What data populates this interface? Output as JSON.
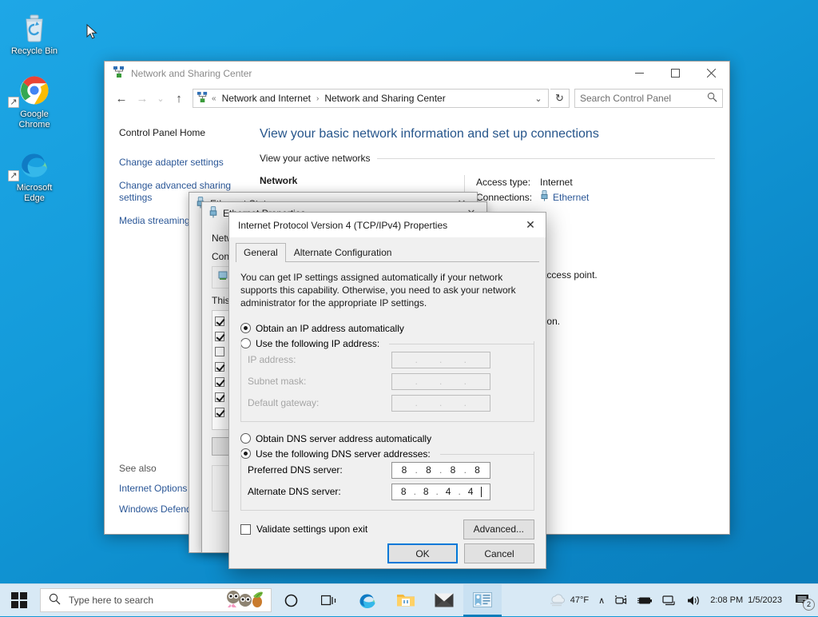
{
  "desktop": {
    "icons": [
      {
        "name": "Recycle Bin",
        "icon": "recycle-bin-icon"
      },
      {
        "name": "Google\nChrome",
        "label_line1": "Google",
        "label_line2": "Chrome",
        "icon": "chrome-icon"
      },
      {
        "name": "Microsoft\nEdge",
        "label_line1": "Microsoft",
        "label_line2": "Edge",
        "icon": "edge-icon"
      }
    ]
  },
  "control_panel_window": {
    "title": "Network and Sharing Center",
    "window_buttons": {
      "minimize": "—",
      "maximize": "☐",
      "close": "✕"
    },
    "nav": {
      "back": "←",
      "forward": "→",
      "recent": "⌄",
      "up": "↑",
      "refresh": "↻",
      "overflow": "«",
      "dropdown": "⌄"
    },
    "breadcrumb": [
      "Network and Internet",
      "Network and Sharing Center"
    ],
    "breadcrumb_separator": "›",
    "search": {
      "placeholder": "Search Control Panel",
      "icon": "search-icon"
    },
    "sidebar": {
      "home": "Control Panel Home",
      "links": [
        "Change adapter settings",
        "Change advanced sharing settings",
        "Media streaming options"
      ],
      "see_also_header": "See also",
      "see_also": [
        "Internet Options",
        "Windows Defender Firewall"
      ]
    },
    "main": {
      "heading": "View your basic network information and set up connections",
      "section_title": "View your active networks",
      "network_name": "Network",
      "access_type_label": "Access type:",
      "access_type_value": "Internet",
      "connections_label": "Connections:",
      "connections_value": "Ethernet",
      "change_settings_text": "set up a router or access point.",
      "troubleshoot_text": "eshooting information."
    }
  },
  "ethernet_status_dialog": {
    "title": "Ethernet Status"
  },
  "ethernet_properties_dialog": {
    "title": "Ethernet Properties",
    "networking_tab": "Networking",
    "connect_label": "Connect using:",
    "items_label": "This connection uses the following items:"
  },
  "ipv4_dialog": {
    "title": "Internet Protocol Version 4 (TCP/IPv4) Properties",
    "close_label": "✕",
    "tabs": [
      {
        "label": "General",
        "active": true
      },
      {
        "label": "Alternate Configuration",
        "active": false
      }
    ],
    "intro": "You can get IP settings assigned automatically if your network supports this capability. Otherwise, you need to ask your network administrator for the appropriate IP settings.",
    "ip_section": {
      "auto_option": "Obtain an IP address automatically",
      "auto_selected": true,
      "manual_option": "Use the following IP address:",
      "manual_selected": false,
      "fields": [
        {
          "label": "IP address:",
          "value": [
            "",
            "",
            "",
            ""
          ]
        },
        {
          "label": "Subnet mask:",
          "value": [
            "",
            "",
            "",
            ""
          ]
        },
        {
          "label": "Default gateway:",
          "value": [
            "",
            "",
            "",
            ""
          ]
        }
      ]
    },
    "dns_section": {
      "auto_option": "Obtain DNS server address automatically",
      "auto_selected": false,
      "manual_option": "Use the following DNS server addresses:",
      "manual_selected": true,
      "fields": [
        {
          "label": "Preferred DNS server:",
          "value": [
            "8",
            "8",
            "8",
            "8"
          ]
        },
        {
          "label": "Alternate DNS server:",
          "value": [
            "8",
            "8",
            "4",
            "4"
          ]
        }
      ]
    },
    "validate_checkbox": "Validate settings upon exit",
    "validate_checked": false,
    "advanced_button": "Advanced...",
    "ok_button": "OK",
    "cancel_button": "Cancel"
  },
  "taskbar": {
    "start": "start-button",
    "search_placeholder": "Type here to search",
    "search_icon": "search-icon",
    "buttons": [
      {
        "name": "cortana-button",
        "icon": "circle-icon"
      },
      {
        "name": "task-view-button",
        "icon": "task-view-icon"
      },
      {
        "name": "edge-taskbar-button",
        "icon": "edge-icon"
      },
      {
        "name": "file-explorer-button",
        "icon": "folder-icon"
      },
      {
        "name": "mail-button",
        "icon": "mail-icon"
      },
      {
        "name": "control-panel-taskbar-button",
        "icon": "control-panel-icon",
        "active": true
      }
    ],
    "weather": "47°F",
    "tray_expand": "∧",
    "time": "2:08 PM",
    "date": "1/5/2023",
    "notification_count": "2"
  },
  "colors": {
    "desktop_blue": "#1399d6",
    "accent": "#0078d7",
    "link": "#2b5797",
    "heading": "#26558b",
    "taskbar": "#d8e9f5",
    "dialog_bg": "#f0f0f0"
  }
}
